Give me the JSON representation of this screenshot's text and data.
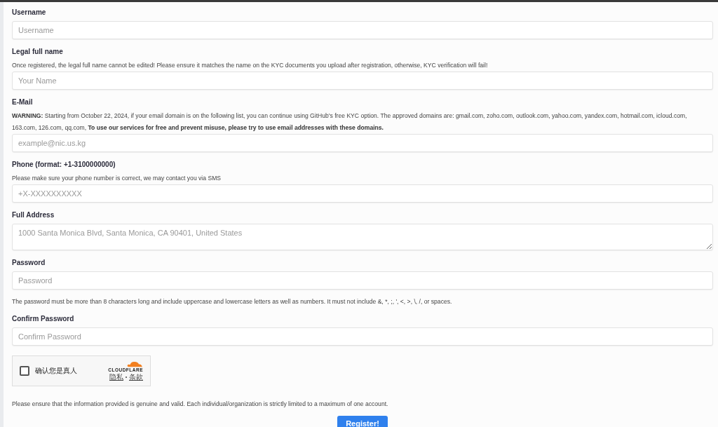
{
  "fields": [
    {
      "kind": "input",
      "label": "Username",
      "placeholder": "Username"
    },
    {
      "kind": "input",
      "label": "Legal full name",
      "help": "Once registered, the legal full name cannot be edited! Please ensure it matches the name on the KYC documents you upload after registration, otherwise, KYC verification will fail!",
      "placeholder": "Your Name"
    },
    {
      "kind": "input",
      "label": "E-Mail",
      "help": "**WARNING:** Starting from October 22, 2024, if your email domain is on the following list, you can continue using GitHub's free KYC option. The approved domains are: gmail.com, zoho.com, outlook.com, yahoo.com, yandex.com, hotmail.com, icloud.com, 163.com, 126.com, qq.com, **To use our services for free and prevent misuse, please try to use email addresses with these domains.**",
      "placeholder": "example@nic.us.kg"
    },
    {
      "kind": "input",
      "label": "Phone (format: +1-3100000000)",
      "help": "Please make sure your phone number is correct, we may contact you via SMS",
      "placeholder": "+X-XXXXXXXXXX"
    },
    {
      "kind": "textarea",
      "label": "Full Address",
      "placeholder": "1000 Santa Monica Blvd, Santa Monica, CA 90401, United States"
    },
    {
      "kind": "input",
      "label": "Password",
      "placeholder": "Password",
      "note": "The password must be more than 8 characters long and include uppercase and lowercase letters as well as numbers. It must not include &, *, ;, ', <, >, \\, /, or spaces."
    },
    {
      "kind": "input",
      "label": "Confirm Password",
      "placeholder": "Confirm Password"
    }
  ],
  "captcha": {
    "label": "确认您是真人",
    "checked": false,
    "brand": "CLOUDFLARE",
    "links": [
      "隐私",
      "条款"
    ]
  },
  "footer_note": "Please ensure that the information provided is genuine and valid. Each individual/organization is strictly limited to a maximum of one account.",
  "submit": "Register!"
}
